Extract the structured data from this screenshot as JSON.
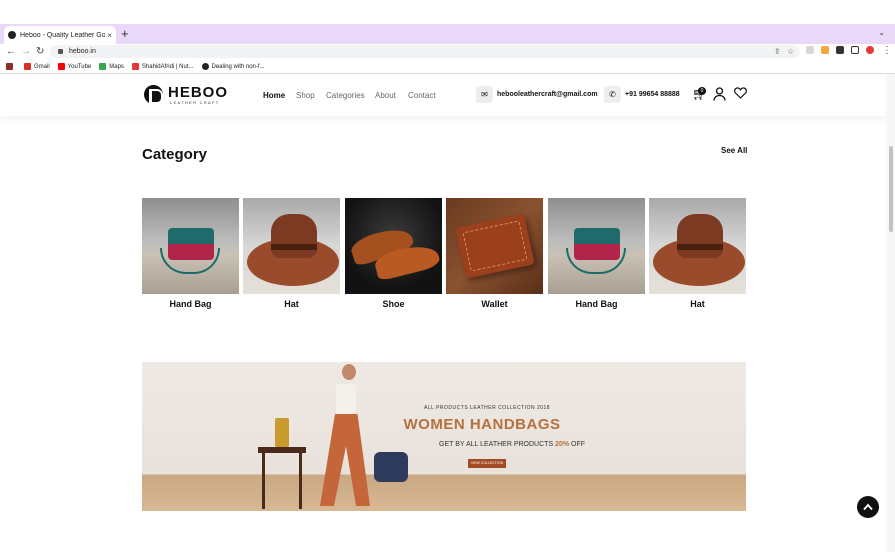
{
  "browser": {
    "tab_title": "Heboo - Quality Leather Goods",
    "tab_close": "×",
    "new_tab": "+",
    "tab_menu": "⌄",
    "url": "heboo.in",
    "bookmarks": [
      {
        "label": "",
        "color": "#8b2d2d"
      },
      {
        "label": "Gmail",
        "color": "#d93025"
      },
      {
        "label": "YouTube",
        "color": "#ff0000"
      },
      {
        "label": "Maps",
        "color": "#34a853"
      },
      {
        "label": "ShahidAfridi | Nut...",
        "color": "#e53935"
      },
      {
        "label": "Dealing with non-f...",
        "color": "#222222"
      }
    ]
  },
  "header": {
    "logo_name": "HEBOO",
    "logo_sub": "LEATHER CRAFT",
    "nav": {
      "home": "Home",
      "shop": "Shop",
      "categories": "Categories",
      "about": "About",
      "contact": "Contact"
    },
    "email": "hebooleathercraft@gmail.com",
    "phone": "+91 99654 88888",
    "cart_count": "0"
  },
  "category": {
    "title": "Category",
    "see_all": "See All",
    "items": [
      {
        "label": "Hand Bag",
        "icon": "handbag"
      },
      {
        "label": "Hat",
        "icon": "hat"
      },
      {
        "label": "Shoe",
        "icon": "shoe"
      },
      {
        "label": "Wallet",
        "icon": "wallet"
      },
      {
        "label": "Hand Bag",
        "icon": "handbag"
      },
      {
        "label": "Hat",
        "icon": "hat"
      }
    ]
  },
  "banner": {
    "eyebrow": "ALL PRODUCTS LEATHER COLLECTION 2018",
    "headline": "WOMEN HANDBAGS",
    "sub_prefix": "GET BY ALL LEATHER PRODUCTS",
    "discount": "20%",
    "sub_suffix": "OFF",
    "cta": "VIEW COLLECTION"
  },
  "colors": {
    "accent": "#b5713f",
    "tabstrip": "#e9d8f7",
    "cta": "#a44b26"
  }
}
